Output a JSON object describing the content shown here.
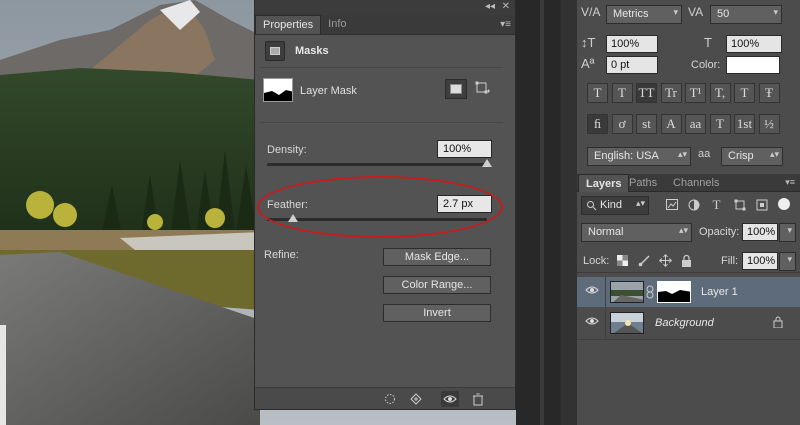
{
  "properties_panel": {
    "tabs": [
      "Properties",
      "Info"
    ],
    "section_title": "Masks",
    "mask_type": "Layer Mask",
    "density": {
      "label": "Density:",
      "value": "100%",
      "fraction": 1.0
    },
    "feather": {
      "label": "Feather:",
      "value": "2.7 px",
      "fraction": 0.12
    },
    "refine_label": "Refine:",
    "buttons": {
      "mask_edge": "Mask Edge...",
      "color_range": "Color Range...",
      "invert": "Invert"
    }
  },
  "character_panel": {
    "kerning": "Metrics",
    "tracking": "50",
    "vertical_scale": "100%",
    "horizontal_scale": "100%",
    "baseline_shift": "0 pt",
    "color_label": "Color:",
    "color_value": "#ffffff",
    "type_style_buttons": [
      "T",
      "T",
      "TT",
      "Tr",
      "T¹",
      "T,",
      "T",
      "Ŧ"
    ],
    "opentype_buttons": [
      "ﬁ",
      "ơ",
      "st",
      "A",
      "aa",
      "T",
      "1st",
      "½"
    ],
    "language": "English: USA",
    "aa_icon": "aa",
    "antialias": "Crisp"
  },
  "layers_panel": {
    "tabs": [
      "Layers",
      "Paths",
      "Channels"
    ],
    "filter_kind": "Kind",
    "blend_mode": "Normal",
    "opacity_label": "Opacity:",
    "opacity": "100%",
    "lock_label": "Lock:",
    "fill_label": "Fill:",
    "fill": "100%",
    "layers": [
      {
        "name": "Layer 1",
        "selected": true,
        "has_mask": true
      },
      {
        "name": "Background",
        "selected": false,
        "locked": true
      }
    ]
  },
  "colors": {
    "highlight_ellipse": "#c81c1c",
    "selected_layer": "#5d6b7a"
  }
}
